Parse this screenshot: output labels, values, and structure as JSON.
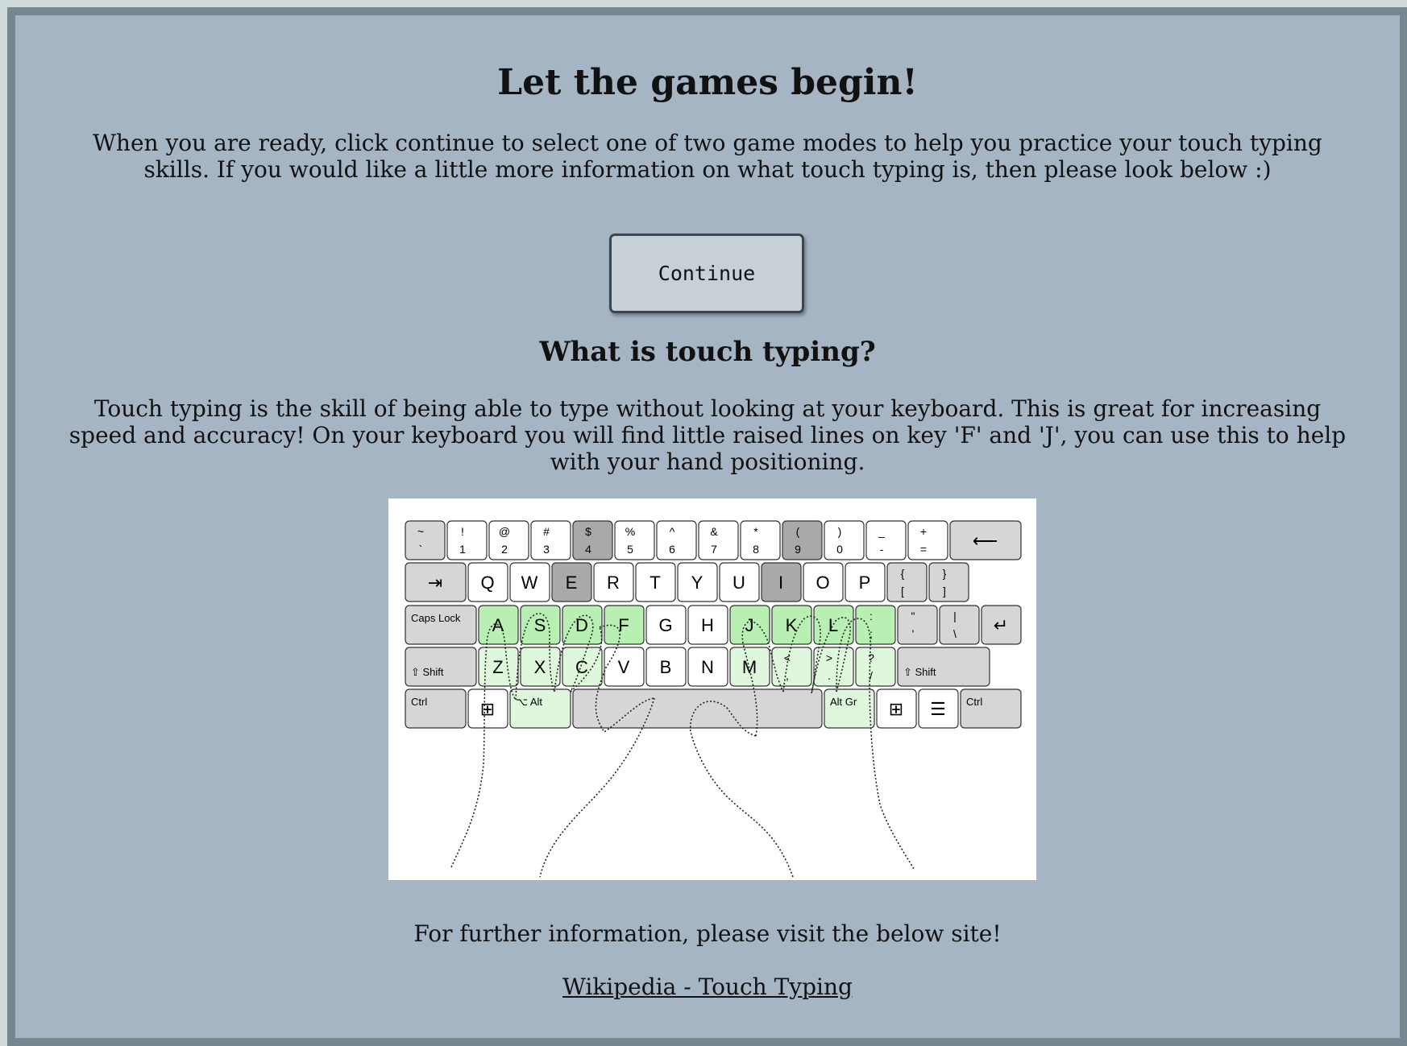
{
  "page": {
    "title": "Let the games begin!",
    "intro": "When you are ready, click continue to select one of two game modes to help you practice your touch typing skills. If you would like a little more information on what touch typing is, then please look below :)",
    "continue_label": "Continue",
    "subtitle": "What is touch typing?",
    "body": "Touch typing is the skill of being able to type without looking at your keyboard. This is great for increasing speed and accuracy! On your keyboard you will find little raised lines on key 'F' and 'J', you can use this to help with your hand positioning.",
    "further": "For further information, please visit the below site!",
    "link_text": "Wikipedia - Touch Typing"
  },
  "keyboard": {
    "rows": [
      [
        [
          "~",
          "`"
        ],
        [
          "!",
          "1"
        ],
        [
          "@",
          "2"
        ],
        [
          "#",
          "3"
        ],
        [
          "$",
          "4"
        ],
        [
          "%",
          "5"
        ],
        [
          "^",
          "6"
        ],
        [
          "&",
          "7"
        ],
        [
          "*",
          "8"
        ],
        [
          "(",
          "9"
        ],
        [
          ")",
          "0"
        ],
        [
          "_",
          "-"
        ],
        [
          "+",
          "="
        ],
        [
          "⟵",
          ""
        ]
      ],
      [
        [
          "⇥",
          ""
        ],
        [
          "Q",
          ""
        ],
        [
          "W",
          ""
        ],
        [
          "E",
          ""
        ],
        [
          "R",
          ""
        ],
        [
          "T",
          ""
        ],
        [
          "Y",
          ""
        ],
        [
          "U",
          ""
        ],
        [
          "I",
          ""
        ],
        [
          "O",
          ""
        ],
        [
          "P",
          ""
        ],
        [
          "{",
          "["
        ],
        [
          "}",
          "]"
        ]
      ],
      [
        [
          "Caps Lock",
          ""
        ],
        [
          "A",
          ""
        ],
        [
          "S",
          ""
        ],
        [
          "D",
          ""
        ],
        [
          "F",
          ""
        ],
        [
          "G",
          ""
        ],
        [
          "H",
          ""
        ],
        [
          "J",
          ""
        ],
        [
          "K",
          ""
        ],
        [
          "L",
          ""
        ],
        [
          ":",
          ";"
        ],
        [
          "\"",
          "'"
        ],
        [
          "|",
          "\\"
        ],
        [
          "↵",
          ""
        ]
      ],
      [
        [
          "⇧ Shift",
          ""
        ],
        [
          "Z",
          ""
        ],
        [
          "X",
          ""
        ],
        [
          "C",
          ""
        ],
        [
          "V",
          ""
        ],
        [
          "B",
          ""
        ],
        [
          "N",
          ""
        ],
        [
          "M",
          ""
        ],
        [
          "<",
          ","
        ],
        [
          ">",
          "."
        ],
        [
          "?",
          "/"
        ],
        [
          "⇧ Shift",
          ""
        ]
      ],
      [
        [
          "Ctrl",
          ""
        ],
        [
          "⊞",
          ""
        ],
        [
          "⌥ Alt",
          ""
        ],
        [
          "",
          ""
        ],
        [
          "Alt Gr",
          ""
        ],
        [
          "⊞",
          ""
        ],
        [
          "☰",
          ""
        ],
        [
          "Ctrl",
          ""
        ]
      ]
    ],
    "colors": {
      "key": "#ffffff",
      "modifier": "#d6d6d6",
      "dark": "#a9a9a9",
      "home": "#b7f0b2",
      "home_light": "#dff7dc"
    }
  }
}
